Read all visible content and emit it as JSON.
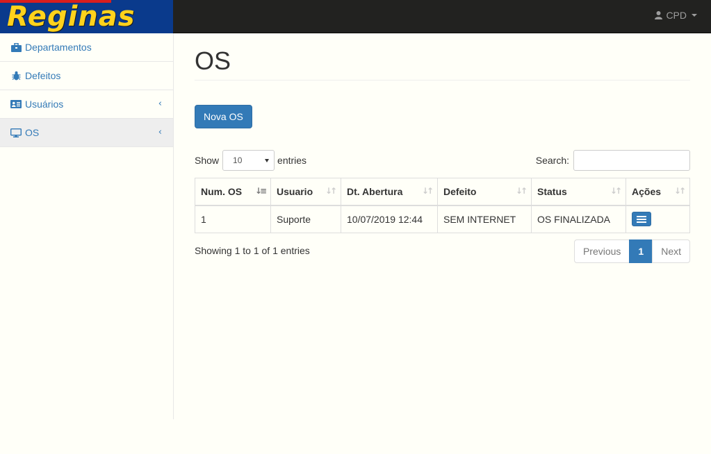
{
  "brand": {
    "logo_text": "Reginas"
  },
  "user_menu": {
    "label": "CPD"
  },
  "sidebar": {
    "items": [
      {
        "label": "Departamentos",
        "icon": "briefcase-icon",
        "has_submenu": false
      },
      {
        "label": "Defeitos",
        "icon": "bug-icon",
        "has_submenu": false
      },
      {
        "label": "Usuários",
        "icon": "id-card-icon",
        "has_submenu": true
      },
      {
        "label": "OS",
        "icon": "desktop-icon",
        "has_submenu": true,
        "active": true
      }
    ]
  },
  "main": {
    "title": "OS",
    "new_button": "Nova OS",
    "length": {
      "before": "Show",
      "value": "10",
      "after": "entries"
    },
    "search": {
      "label": "Search:",
      "value": ""
    },
    "table": {
      "columns": [
        "Num. OS",
        "Usuario",
        "Dt. Abertura",
        "Defeito",
        "Status",
        "Ações"
      ],
      "rows": [
        [
          "1",
          "Suporte",
          "10/07/2019 12:44",
          "SEM INTERNET",
          "OS FINALIZADA"
        ]
      ]
    },
    "info": "Showing 1 to 1 of 1 entries",
    "pagination": {
      "previous": "Previous",
      "current": "1",
      "next": "Next"
    }
  },
  "colors": {
    "primary": "#337ab7",
    "navbar": "#222220",
    "logo_yellow": "#ffd21c",
    "logo_blue": "#0a3a8c"
  }
}
